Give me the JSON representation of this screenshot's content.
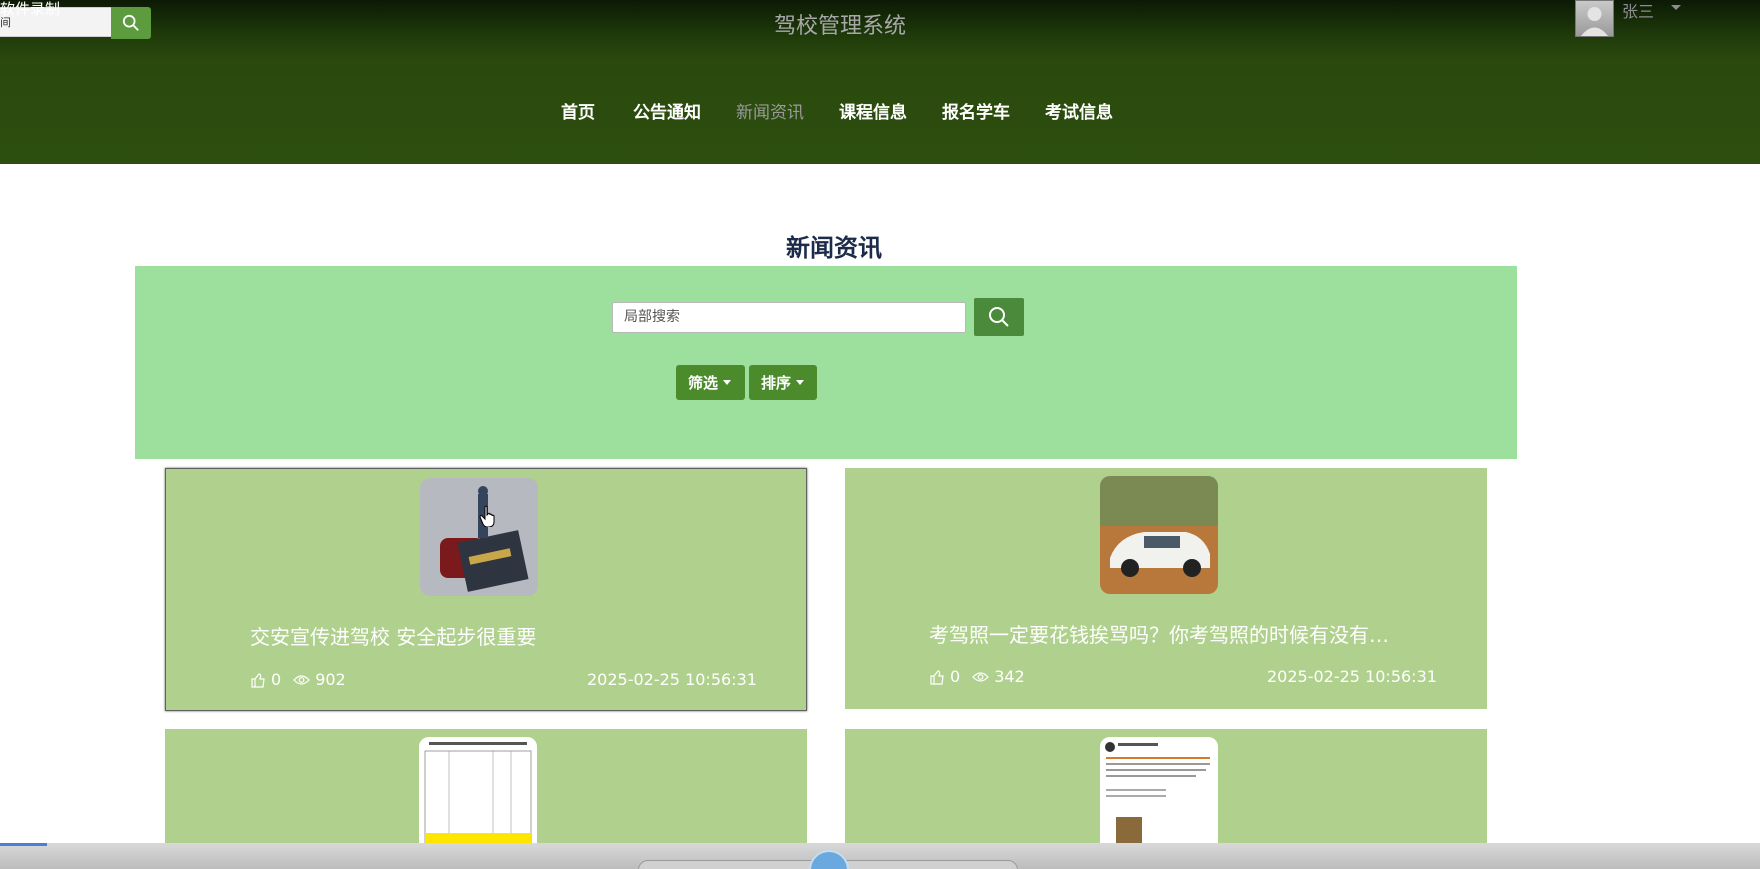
{
  "overlay": {
    "recorder_label": "软件录制",
    "left_glyph": "间"
  },
  "header": {
    "site_title": "驾校管理系统",
    "user_name": "张三",
    "nav": [
      {
        "label": "首页",
        "active": false
      },
      {
        "label": "公告通知",
        "active": false
      },
      {
        "label": "新闻资讯",
        "active": true
      },
      {
        "label": "课程信息",
        "active": false
      },
      {
        "label": "报名学车",
        "active": false
      },
      {
        "label": "考试信息",
        "active": false
      }
    ]
  },
  "section": {
    "title": "新闻资讯",
    "search_placeholder": "局部搜索",
    "filter_label": "筛选",
    "sort_label": "排序"
  },
  "cards": [
    {
      "title": "交安宣传进驾校 安全起步很重要",
      "likes": "0",
      "views": "902",
      "date": "2025-02-25 10:56:31"
    },
    {
      "title": "考驾照一定要花钱挨骂吗？你考驾照的时候有没有…",
      "likes": "0",
      "views": "342",
      "date": "2025-02-25 10:56:31"
    },
    {
      "title": "",
      "likes": "",
      "views": "",
      "date": ""
    },
    {
      "title": "",
      "likes": "",
      "views": "",
      "date": ""
    }
  ],
  "colors": {
    "header_bg": "#2c4e0e",
    "panel_bg": "#9de09d",
    "card_bg": "#b0d18e",
    "button_green": "#4b8b2b",
    "title_navy": "#1d2b4a"
  }
}
